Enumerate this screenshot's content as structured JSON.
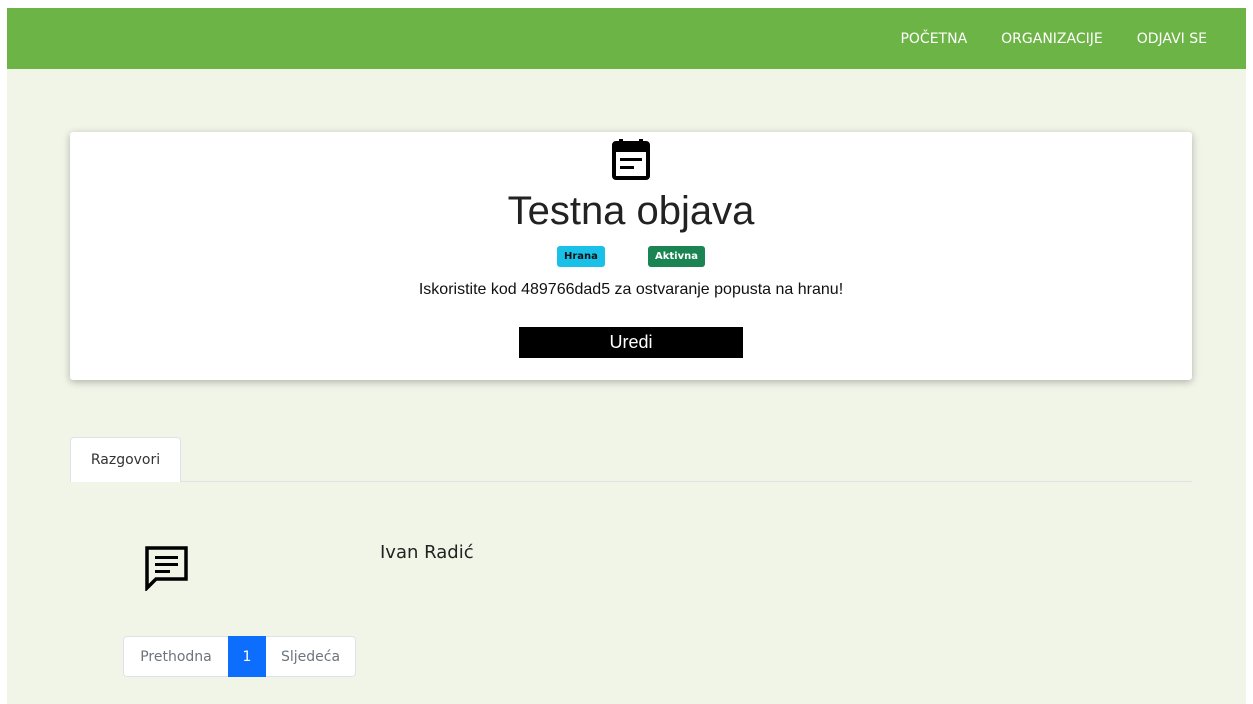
{
  "nav": {
    "home": "POČETNA",
    "organizations": "ORGANIZACIJE",
    "logout": "ODJAVI SE"
  },
  "post": {
    "icon": "calendar-note-icon",
    "title": "Testna objava",
    "category": "Hrana",
    "status": "Aktivna",
    "description": "Iskoristite kod 489766dad5 za ostvaranje popusta na hranu!",
    "edit_label": "Uredi"
  },
  "tabs": [
    {
      "label": "Razgovori"
    }
  ],
  "conversations": [
    {
      "icon": "message-icon",
      "name": "Ivan Radić"
    }
  ],
  "pagination": {
    "prev": "Prethodna",
    "current": "1",
    "next": "Sljedeća"
  },
  "colors": {
    "navbar": "#6db446",
    "background": "#f1f5e8",
    "badge_category": "#19c0e8",
    "badge_status": "#1b8453",
    "page_active": "#0d6efd"
  }
}
